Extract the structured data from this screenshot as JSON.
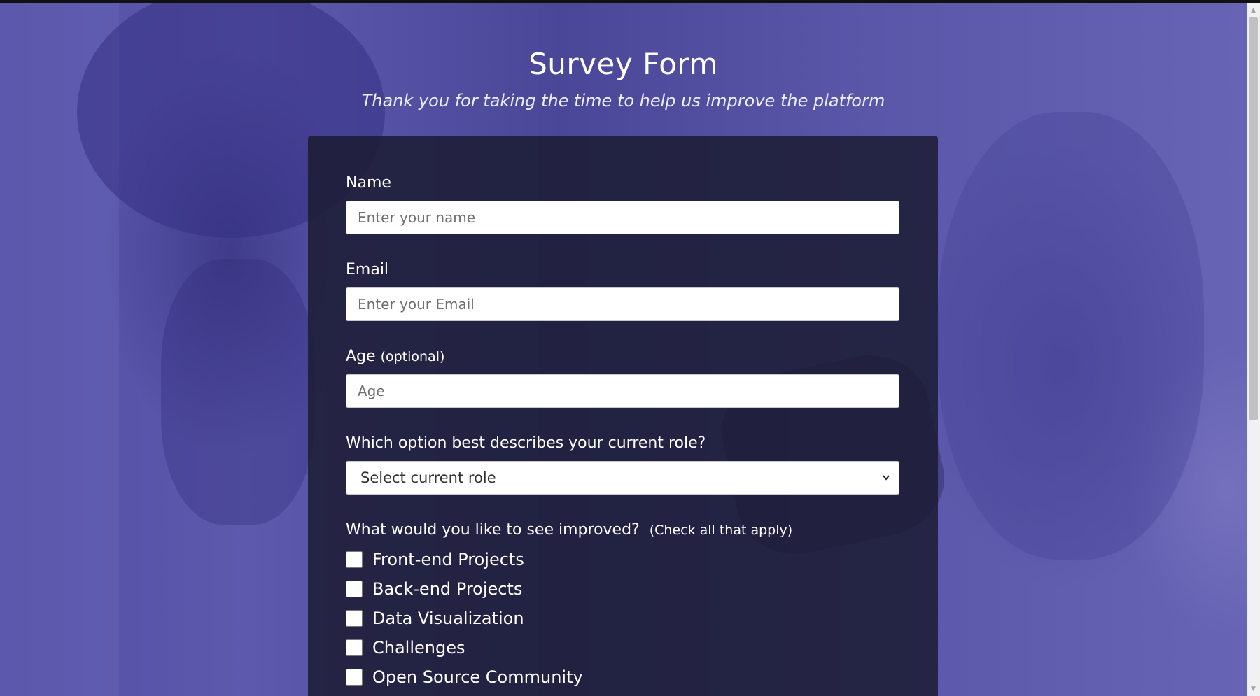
{
  "page": {
    "title": "Survey Form",
    "description": "Thank you for taking the time to help us improve the platform"
  },
  "form": {
    "name": {
      "label": "Name",
      "placeholder": "Enter your name"
    },
    "email": {
      "label": "Email",
      "placeholder": "Enter your Email"
    },
    "age": {
      "label": "Age",
      "clue": "(optional)",
      "placeholder": "Age"
    },
    "role": {
      "label": "Which option best describes your current role?",
      "selected": "Select current role"
    },
    "improve": {
      "label": "What would you like to see improved?",
      "clue": "(Check all that apply)",
      "options": [
        "Front-end Projects",
        "Back-end Projects",
        "Data Visualization",
        "Challenges",
        "Open Source Community"
      ]
    }
  },
  "colors": {
    "background_overlay": "#5a56a8",
    "card": "#1b1b32",
    "text": "#ffffff"
  },
  "icons": {
    "select_arrow": "chevron-down-icon",
    "scroll_up": "scroll-up-arrow-icon",
    "scroll_down": "scroll-down-arrow-icon"
  }
}
